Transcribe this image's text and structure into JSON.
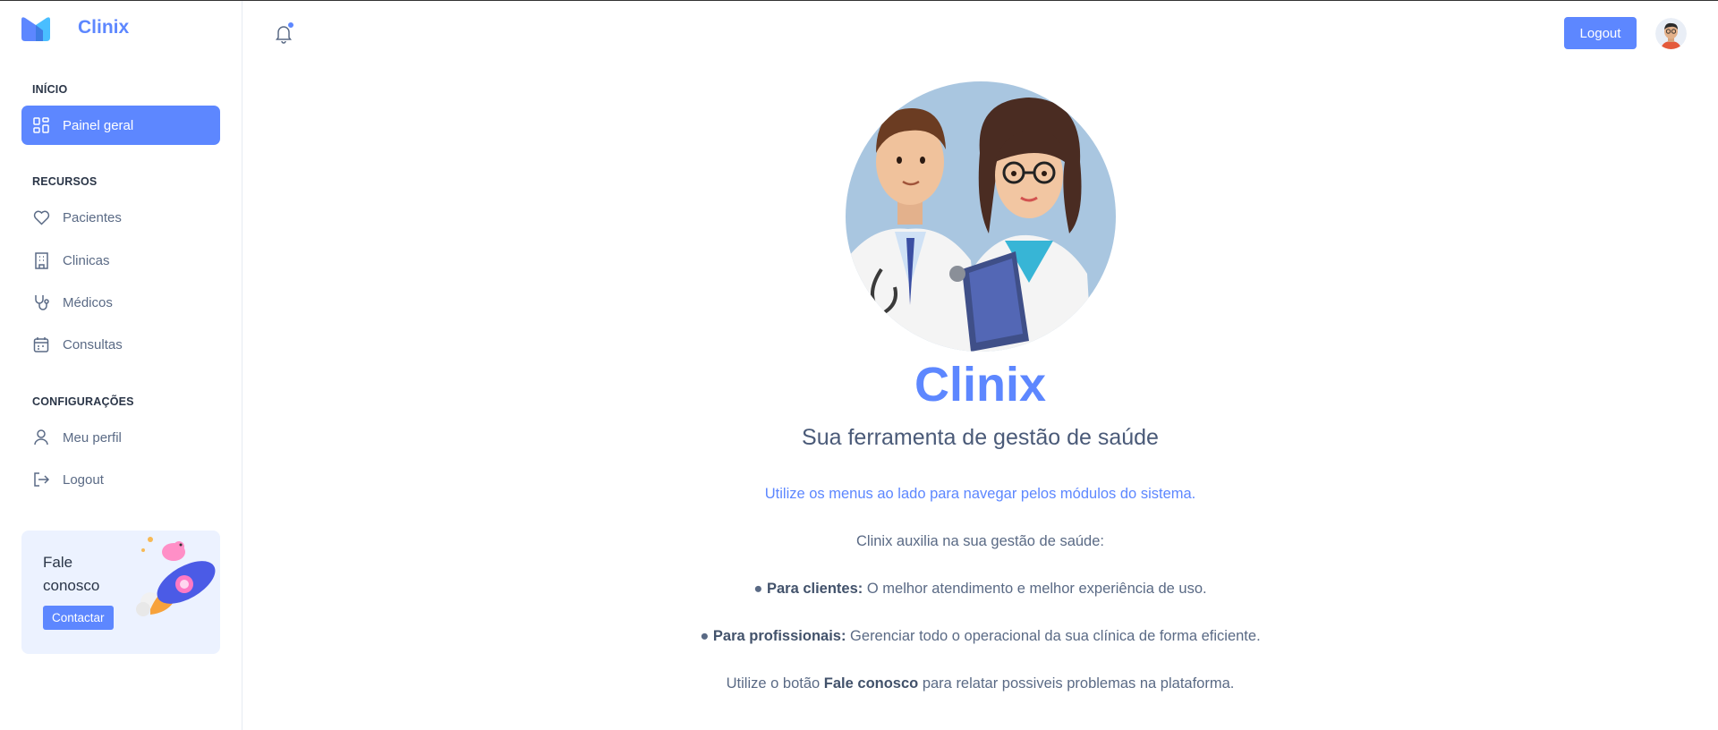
{
  "app": {
    "name": "Clinix"
  },
  "sidebar": {
    "sections": [
      {
        "title": "INÍCIO"
      },
      {
        "title": "RECURSOS"
      },
      {
        "title": "CONFIGURAÇÕES"
      }
    ],
    "items": [
      {
        "label": "Painel geral",
        "icon": "dashboard-icon",
        "active": true
      },
      {
        "label": "Pacientes",
        "icon": "heart-icon"
      },
      {
        "label": "Clinicas",
        "icon": "building-icon"
      },
      {
        "label": "Médicos",
        "icon": "stethoscope-icon"
      },
      {
        "label": "Consultas",
        "icon": "calendar-icon"
      },
      {
        "label": "Meu perfil",
        "icon": "user-icon"
      },
      {
        "label": "Logout",
        "icon": "logout-icon"
      }
    ],
    "promo": {
      "title": "Fale conosco",
      "button": "Contactar"
    }
  },
  "header": {
    "logout_label": "Logout",
    "notification_dot": true
  },
  "main": {
    "title": "Clinix",
    "subtitle": "Sua ferramenta de gestão de saúde",
    "hint": "Utilize os menus ao lado para navegar pelos módulos do sistema.",
    "intro": "Clinix auxilia na sua gestão de saúde:",
    "bullets": [
      {
        "bold": "Para clientes:",
        "text": " O melhor atendimento e melhor experiência de uso."
      },
      {
        "bold": "Para profissionais:",
        "text": " Gerenciar todo o operacional da sua clínica de forma eficiente."
      }
    ],
    "footer": {
      "pre": "Utilize o botão ",
      "bold": "Fale conosco",
      "post": " para relatar possiveis problemas na plataforma."
    }
  },
  "colors": {
    "accent": "#5d87ff",
    "promo_bg": "#ecf2ff"
  }
}
